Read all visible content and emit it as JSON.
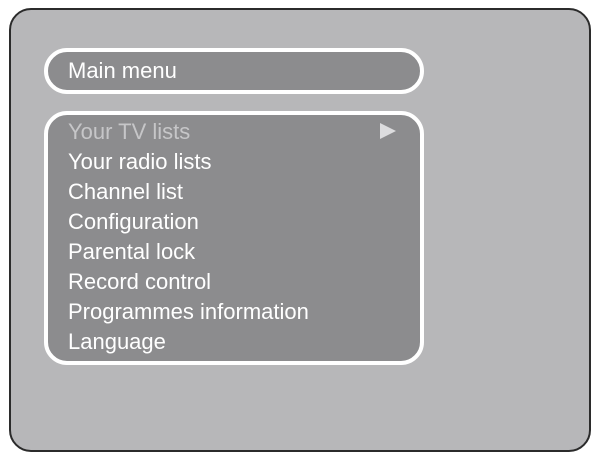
{
  "header": {
    "title": "Main menu"
  },
  "menu": {
    "items": [
      {
        "label": "Your TV lists",
        "selected": true,
        "has_submenu": true
      },
      {
        "label": "Your radio lists"
      },
      {
        "label": "Channel list"
      },
      {
        "label": "Configuration"
      },
      {
        "label": "Parental lock"
      },
      {
        "label": "Record control"
      },
      {
        "label": "Programmes information"
      },
      {
        "label": "Language"
      }
    ],
    "submenu_icon": "triangle-right-icon"
  },
  "colors": {
    "screen_background": "#b7b7b9",
    "panel_background": "#8c8c8e",
    "panel_border": "#ffffff",
    "text": "#ffffff",
    "selected_text": "#c6c6c8"
  }
}
